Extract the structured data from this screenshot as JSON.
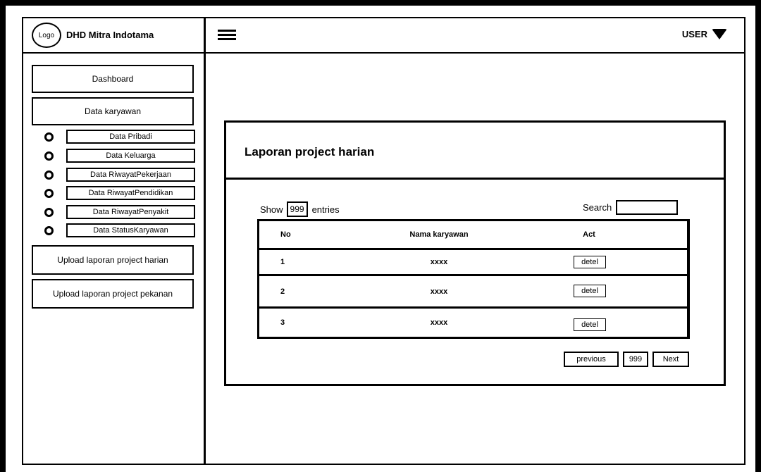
{
  "sidebar": {
    "logo_text": "Logo",
    "brand": "DHD Mitra Indotama",
    "dashboard": "Dashboard",
    "data_karyawan": "Data karyawan",
    "sub_items": [
      "Data Pribadi",
      "Data Keluarga",
      "Data RiwayatPekerjaan",
      "Data RiwayatPendidikan",
      "Data RiwayatPenyakit",
      "Data StatusKaryawan"
    ],
    "upload_harian": "Upload laporan project harian",
    "upload_pekanan": "Upload laporan project pekanan"
  },
  "header": {
    "menu_icon": "hamburger-menu-icon",
    "user_label": "USER",
    "user_icon": "caret-down-icon"
  },
  "card": {
    "title": "Laporan project harian",
    "show_label": "Show",
    "show_value": "999",
    "entries_label": "entries",
    "search_label": "Search",
    "table": {
      "headers": [
        "No",
        "Nama karyawan",
        "Act"
      ],
      "rows": [
        {
          "no": "1",
          "nama": "xxxx",
          "act": "detel"
        },
        {
          "no": "2",
          "nama": "xxxx",
          "act": "detel"
        },
        {
          "no": "3",
          "nama": "xxxx",
          "act": "detel"
        }
      ]
    },
    "pagination": {
      "previous": "previous",
      "page": "999",
      "next": "Next"
    }
  }
}
